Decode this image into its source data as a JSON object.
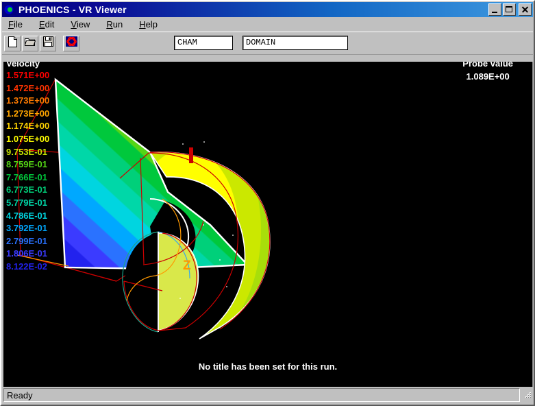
{
  "window": {
    "title": "PHOENICS - VR Viewer",
    "icon": "phoenics-logo-icon",
    "minimize_label": "Minimize",
    "maximize_label": "Maximize",
    "close_label": "Close"
  },
  "menu": [
    {
      "name": "file",
      "accel": "F",
      "rest": "ile"
    },
    {
      "name": "edit",
      "accel": "E",
      "rest": "dit"
    },
    {
      "name": "view",
      "accel": "V",
      "rest": "iew"
    },
    {
      "name": "run",
      "accel": "R",
      "rest": "un"
    },
    {
      "name": "help",
      "accel": "H",
      "rest": "elp"
    }
  ],
  "toolbar": {
    "buttons": [
      {
        "name": "new-file-button",
        "icon": "new-document-icon"
      },
      {
        "name": "open-file-button",
        "icon": "open-folder-icon"
      },
      {
        "name": "save-file-button",
        "icon": "floppy-disk-icon"
      },
      {
        "name": "geometry-button",
        "icon": "geometry-object-icon"
      }
    ],
    "case_field": {
      "value": "CHAM",
      "placeholder": "CHAM"
    },
    "object_field": {
      "value": "DOMAIN",
      "placeholder": "DOMAIN"
    }
  },
  "viewport": {
    "legend": {
      "title": "Velocity",
      "entries": [
        {
          "value": "1.571E+00",
          "color": "#ff0000"
        },
        {
          "value": "1.472E+00",
          "color": "#ff3300"
        },
        {
          "value": "1.373E+00",
          "color": "#ff7b00"
        },
        {
          "value": "1.273E+00",
          "color": "#ffa500"
        },
        {
          "value": "1.174E+00",
          "color": "#ffd400"
        },
        {
          "value": "1.075E+00",
          "color": "#ffff00"
        },
        {
          "value": "9.753E-01",
          "color": "#cbe800"
        },
        {
          "value": "8.759E-01",
          "color": "#55d515"
        },
        {
          "value": "7.766E-01",
          "color": "#00c83c"
        },
        {
          "value": "6.773E-01",
          "color": "#00d07a"
        },
        {
          "value": "5.779E-01",
          "color": "#00d7a8"
        },
        {
          "value": "4.786E-01",
          "color": "#00d5e0"
        },
        {
          "value": "3.792E-01",
          "color": "#00a8ff"
        },
        {
          "value": "2.799E-01",
          "color": "#2a72ff"
        },
        {
          "value": "1.806E-01",
          "color": "#3b3bff"
        },
        {
          "value": "8.122E-02",
          "color": "#2222ee"
        }
      ]
    },
    "probe": {
      "label": "Probe value",
      "value": "1.089E+00"
    },
    "run_title": "No title has been set for this run.",
    "axis_label_z": "Z",
    "colors": {
      "background": "#000000",
      "wireframe": "#cc0000",
      "axis": "#ff9900",
      "edge_highlight": "#ffffff"
    }
  },
  "statusbar": {
    "text": "Ready"
  }
}
